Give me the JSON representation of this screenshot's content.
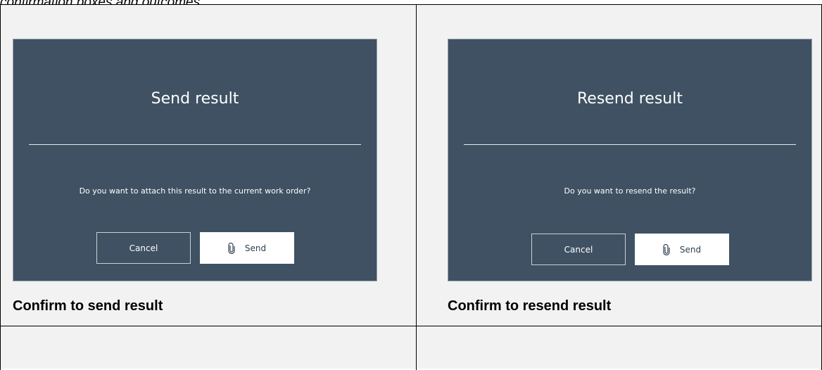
{
  "doc": {
    "top_caption": "confirmation boxes and outcomes."
  },
  "panels": [
    {
      "dialog_title": "Send result",
      "message": "Do you want to attach this result to the current work order?",
      "cancel_label": "Cancel",
      "send_label": "Send",
      "send_icon": "paperclip-icon",
      "caption": "Confirm to send result"
    },
    {
      "dialog_title": "Resend result",
      "message": "Do you want to resend the result?",
      "cancel_label": "Cancel",
      "send_label": "Send",
      "send_icon": "paperclip-icon",
      "caption": "Confirm to resend result"
    }
  ],
  "colors": {
    "dialog_bg": "#3f5163",
    "cell_bg": "#f2f2f2"
  }
}
